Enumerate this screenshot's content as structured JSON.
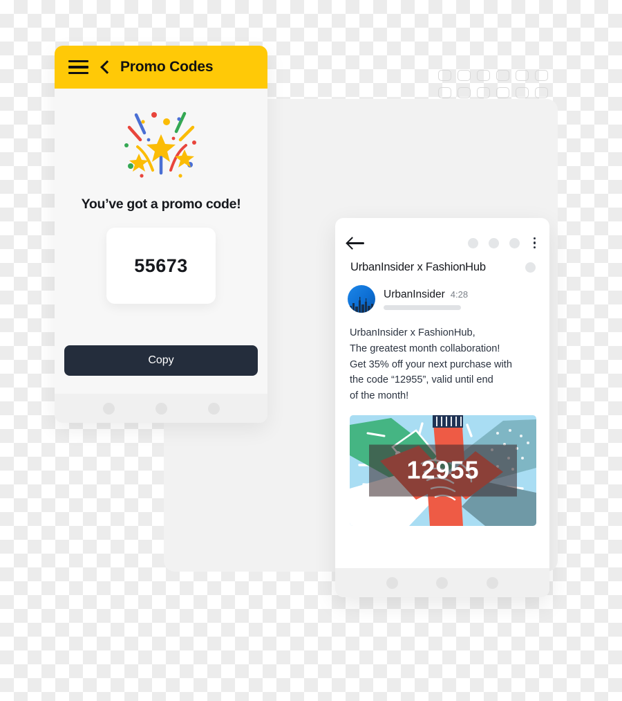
{
  "colors": {
    "header_yellow": "#FFC907",
    "copy_button": "#242D3C",
    "text_dark": "#16181D",
    "panel_gray": "#F2F2F2",
    "avatar_blue": "#0D6FD4",
    "illustration_sky": "#A9DDF3",
    "illustration_red": "#EE5B45",
    "illustration_green": "#45B583"
  },
  "phone_promo": {
    "header": {
      "menu_icon": "hamburger-menu-icon",
      "back_icon": "chevron-left-icon",
      "title": "Promo Codes"
    },
    "illustration": "confetti-celebration-icon",
    "heading": "You’ve got a promo code!",
    "promo_code": "55673",
    "copy_label": "Copy",
    "nav_dots": 3
  },
  "phone_email": {
    "toolbar": {
      "back_icon": "arrow-left-icon",
      "placeholder_circles": 3,
      "overflow_icon": "kebab-menu-icon"
    },
    "subject": "UrbanInsider x FashionHub",
    "sender": {
      "avatar": "city-skyline-avatar",
      "name": "UrbanInsider",
      "time": "4:28"
    },
    "body_lines": [
      "UrbanInsider x FashionHub,",
      "The greatest month collaboration!",
      "Get 35% off your next purchase with",
      "the code “12955”, valid until end",
      "of the month!"
    ],
    "promo_image": {
      "alt": "hands-stacked-teamwork-illustration",
      "overlay_code": "12955"
    },
    "nav_dots": 3
  }
}
